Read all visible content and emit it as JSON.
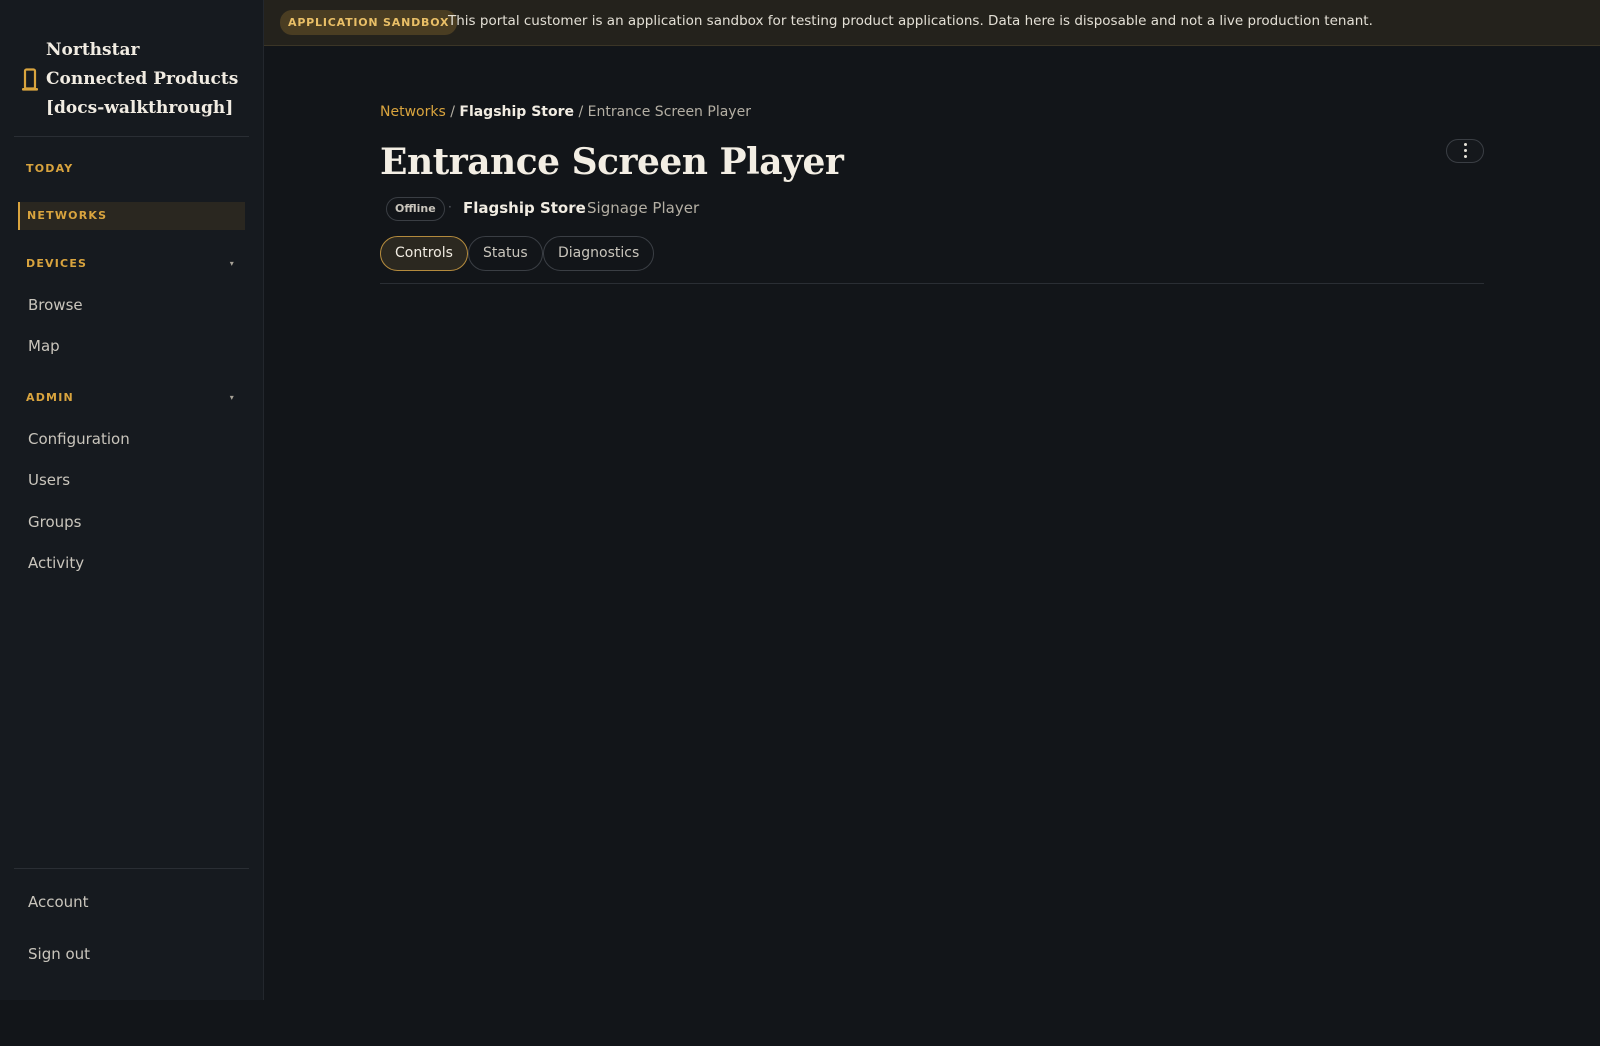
{
  "brand": {
    "title": "Northstar Connected Products [docs-walkthrough]",
    "icon": "phone-device-icon",
    "accent_color": "#d9a43e"
  },
  "sidebar": {
    "today_label": "TODAY",
    "networks_label": "NETWORKS",
    "devices": {
      "label": "DEVICES",
      "caret": "▾",
      "items": [
        "Browse",
        "Map"
      ]
    },
    "admin": {
      "label": "ADMIN",
      "caret": "▾",
      "items": [
        "Configuration",
        "Users",
        "Groups",
        "Activity"
      ]
    },
    "footer": {
      "account_label": "Account",
      "signout_label": "Sign out"
    }
  },
  "banner": {
    "badge": "APPLICATION SANDBOX",
    "text": "This portal customer is an application sandbox for testing product applications. Data here is disposable and not a live production tenant."
  },
  "breadcrumb": {
    "root": "Networks",
    "sep1": "/",
    "parent": "Flagship Store",
    "sep2": "/",
    "current": "Entrance Screen Player"
  },
  "page": {
    "title": "Entrance Screen Player",
    "more_icon": "vertical-ellipsis-icon",
    "status": "Offline",
    "dot1": "·",
    "store": "Flagship Store",
    "dot2": "·",
    "device_type": "Signage Player"
  },
  "tabs": [
    {
      "label": "Controls",
      "active": true
    },
    {
      "label": "Status",
      "active": false
    },
    {
      "label": "Diagnostics",
      "active": false
    }
  ]
}
